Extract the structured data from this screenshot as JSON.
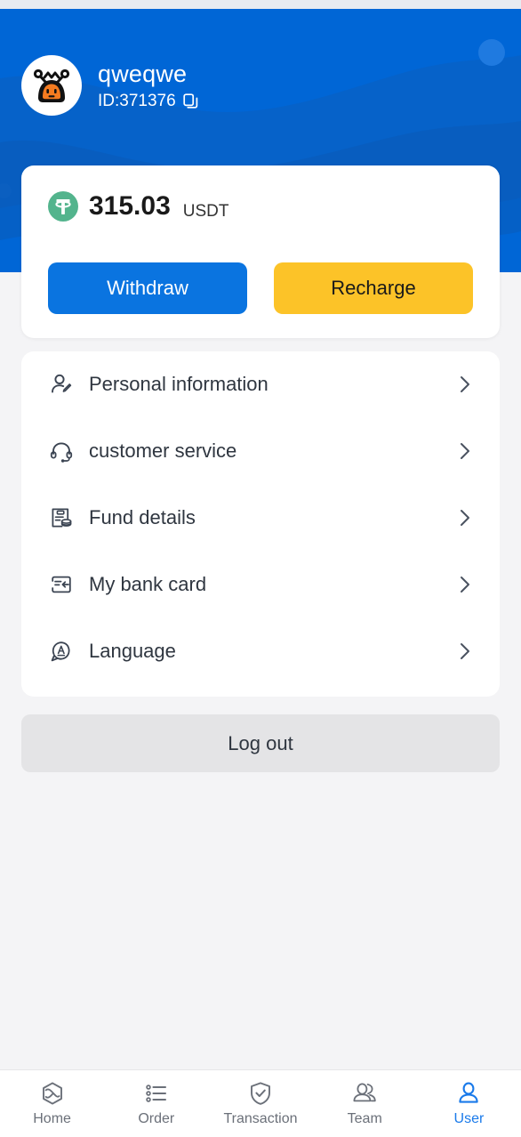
{
  "theme": {
    "header_blue": "#0066d6",
    "wave_blue": "#0b5fc0",
    "accent_blue": "#0a74e0",
    "accent_yellow": "#fcc328",
    "page_bg": "#f4f4f6",
    "usdt_green": "#53b48d",
    "active_nav": "#1a7aea",
    "text_dark": "#2f3640"
  },
  "profile": {
    "name": "qweqwe",
    "id_label": "ID:371376",
    "avatar_icon": "robot-mascot-avatar",
    "copy_icon": "copy-icon"
  },
  "balance": {
    "currency_icon": "usdt-tether-icon",
    "amount": "315.03",
    "unit": "USDT",
    "withdraw_label": "Withdraw",
    "recharge_label": "Recharge"
  },
  "menu": {
    "items": [
      {
        "label": "Personal information",
        "icon": "user-edit-icon"
      },
      {
        "label": "customer service",
        "icon": "headset-icon"
      },
      {
        "label": "Fund details",
        "icon": "clipboard-coins-icon"
      },
      {
        "label": "My bank card",
        "icon": "bank-card-icon"
      },
      {
        "label": "Language",
        "icon": "language-bubble-icon"
      }
    ],
    "chevron_icon": "chevron-right-icon"
  },
  "logout": {
    "label": "Log out"
  },
  "bottom_nav": {
    "items": [
      {
        "label": "Home",
        "icon": "hexagon-home-icon",
        "active": false
      },
      {
        "label": "Order",
        "icon": "list-order-icon",
        "active": false
      },
      {
        "label": "Transaction",
        "icon": "shield-check-icon",
        "active": false
      },
      {
        "label": "Team",
        "icon": "users-team-icon",
        "active": false
      },
      {
        "label": "User",
        "icon": "user-profile-icon",
        "active": true
      }
    ]
  }
}
